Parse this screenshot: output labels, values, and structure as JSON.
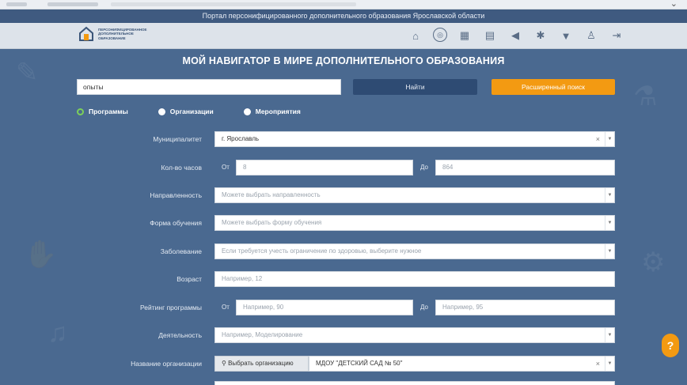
{
  "portal": {
    "title": "Портал персонифицированного дополнительного образования Ярославской области",
    "logo_text": "ПЕРСОНИФИЦИРОВАННОЕ ДОПОЛНИТЕЛЬНОЕ ОБРАЗОВАНИЕ"
  },
  "nav_icons": [
    "home-icon",
    "target-icon",
    "calendar-icon",
    "document-icon",
    "megaphone-icon",
    "star-icon",
    "trophy-icon",
    "people-icon",
    "logout-icon"
  ],
  "main": {
    "title": "МОЙ НАВИГАТОР В МИРЕ ДОПОЛНИТЕЛЬНОГО ОБРАЗОВАНИЯ",
    "search_value": "опыты",
    "find_label": "Найти",
    "advanced_label": "Расширенный поиск"
  },
  "radios": [
    {
      "label": "Программы",
      "selected": true
    },
    {
      "label": "Организации",
      "selected": false
    },
    {
      "label": "Мероприятия",
      "selected": false
    }
  ],
  "filters": {
    "municipality": {
      "label": "Муниципалитет",
      "value": "г. Ярославль"
    },
    "hours": {
      "label": "Кол-во часов",
      "from_label": "От",
      "from_value": "8",
      "to_label": "До",
      "to_value": "864"
    },
    "direction": {
      "label": "Направленность",
      "placeholder": "Можете выбрать направленность"
    },
    "form": {
      "label": "Форма обучения",
      "placeholder": "Можете выбрать форму обучения"
    },
    "disease": {
      "label": "Заболевание",
      "placeholder": "Если требуется учесть ограничение по здоровью, выберите нужное"
    },
    "age": {
      "label": "Возраст",
      "placeholder": "Например, 12"
    },
    "rating": {
      "label": "Рейтинг программы",
      "from_label": "От",
      "from_placeholder": "Например, 90",
      "to_label": "До",
      "to_placeholder": "Например, 95"
    },
    "activity": {
      "label": "Деятельность",
      "placeholder": "Например, Моделирование"
    },
    "organization": {
      "label": "Название организации",
      "button_label": "Выбрать организацию",
      "value": "МДОУ \"ДЕТСКИЙ САД № 50\""
    }
  },
  "help_label": "?",
  "colors": {
    "header": "#3f5a80",
    "main_bg": "#4a6990",
    "accent_orange": "#f39a12",
    "button_dark": "#2e4b73",
    "radio_on": "#7cd05a"
  }
}
